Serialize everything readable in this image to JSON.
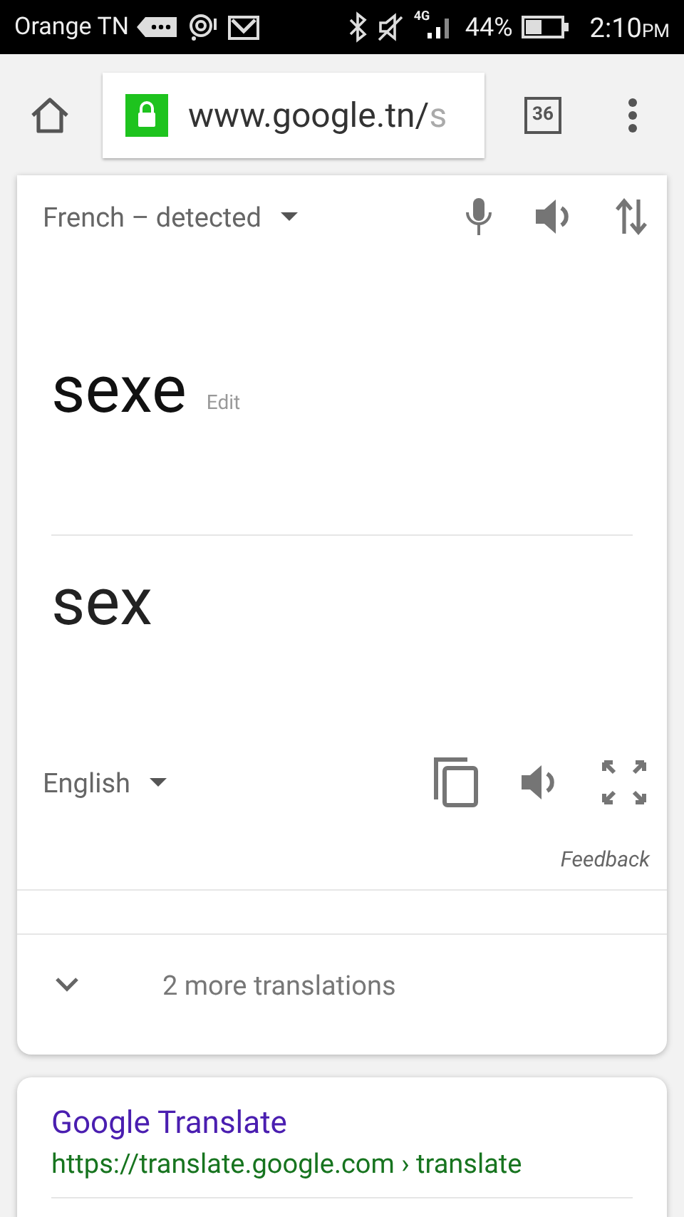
{
  "status_bar": {
    "carrier": "Orange TN",
    "battery_percent": "44%",
    "time": "2:10",
    "time_suffix": "PM",
    "network": "4G"
  },
  "browser": {
    "url": "www.google.tn/",
    "url_tail": "s",
    "tab_count": "36"
  },
  "translate": {
    "source_language": "French – detected",
    "source_text": "sexe",
    "edit_label": "Edit",
    "target_text": "sex",
    "target_language": "English",
    "feedback": "Feedback",
    "more_translations": "2 more translations",
    "expanded": false
  },
  "result": {
    "title": "Google Translate",
    "url": "https://translate.google.com › translate"
  }
}
